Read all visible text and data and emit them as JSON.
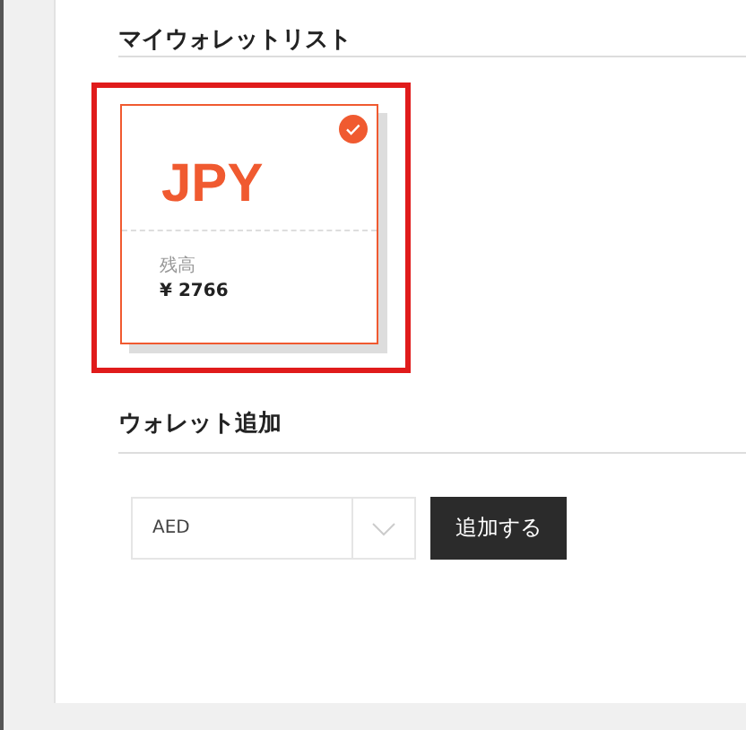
{
  "wallet_list": {
    "title": "マイウォレットリスト",
    "highlighted": true,
    "wallets": [
      {
        "currency": "JPY",
        "balance_label": "残高",
        "balance": "¥ 2766",
        "selected": true
      }
    ]
  },
  "add_wallet": {
    "title": "ウォレット追加",
    "currency_select": {
      "value": "AED"
    },
    "add_button": "追加する"
  }
}
